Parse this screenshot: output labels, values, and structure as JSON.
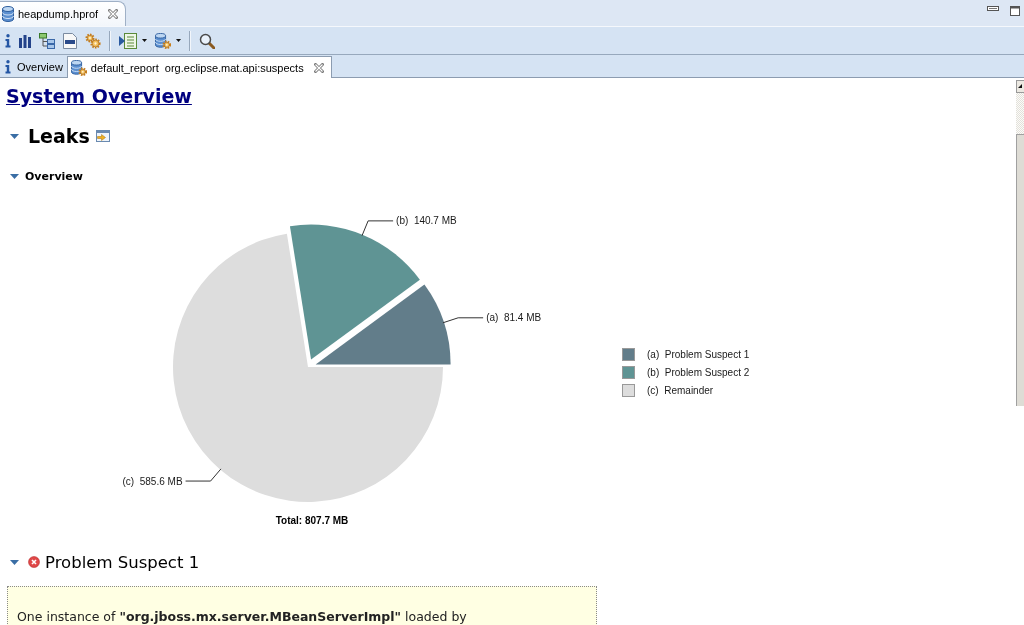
{
  "editor_tabs": [
    {
      "label": "heapdump.hprof",
      "selected": true,
      "closable": true
    }
  ],
  "view_tabs": [
    {
      "kind": "overview",
      "label": "Overview",
      "selected": false,
      "closable": false
    },
    {
      "kind": "report",
      "label": "default_report  org.eclipse.mat.api:suspects",
      "selected": true,
      "closable": true
    }
  ],
  "report": {
    "title": "System Overview",
    "leaks": {
      "heading": "Leaks",
      "expanded": true,
      "overview": {
        "heading": "Overview",
        "expanded": true,
        "chart_data": {
          "type": "pie",
          "title": "Total: 807.7 MB",
          "categories": [
            "(a)  Problem Suspect 1",
            "(b)  Problem Suspect 2",
            "(c)  Remainder"
          ],
          "values": [
            81.4,
            140.7,
            585.6
          ],
          "colors": [
            "#627d8a",
            "#5f9494",
            "#dddddd"
          ],
          "value_labels": [
            "(a)  81.4 MB",
            "(b)  140.7 MB",
            "(c)  585.6 MB"
          ],
          "legend": "right"
        }
      }
    },
    "suspects": [
      {
        "heading": "Problem Suspect 1",
        "expanded": true,
        "description": "One instance of **\"org.jboss.mx.server.MBeanServerImpl\"** loaded by"
      }
    ]
  }
}
